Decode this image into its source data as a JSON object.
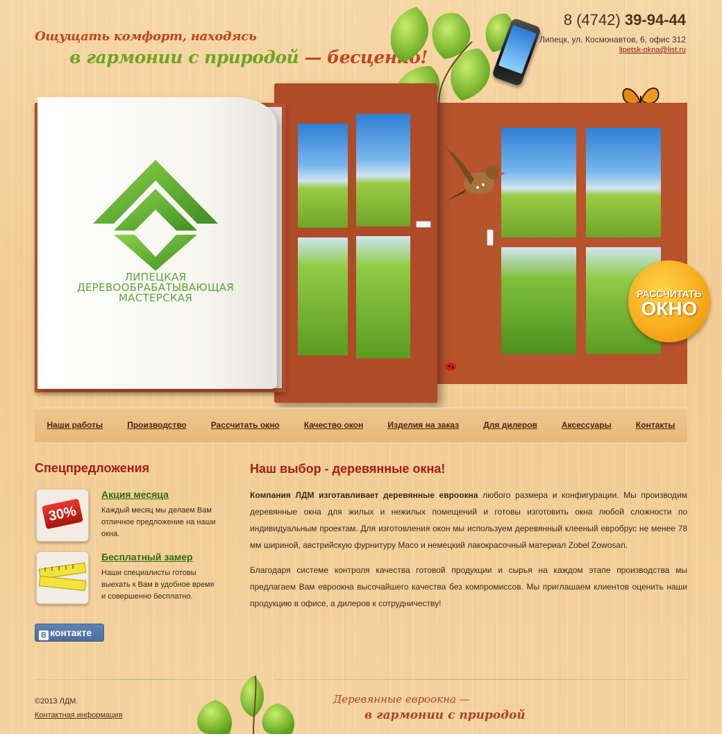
{
  "header": {
    "slogan_line1": "Ощущать комфорт, находясь",
    "slogan_line2_green": "в гармонии с природой",
    "slogan_line2_red": " — бесценно!",
    "phone_prefix": "8 (4742) ",
    "phone_number": "39-94-44",
    "address": "Липецк, ул. Космонавтов, 6, офис 312",
    "email": "lipetsk-okna@list.ru"
  },
  "hero": {
    "logo_line1": "ЛИПЕЦКАЯ",
    "logo_line2": "ДЕРЕВООБРАБАТЫВАЮЩАЯ",
    "logo_line3": "МАСТЕРСКАЯ",
    "calc_line1": "РАССЧИТАТЬ",
    "calc_line2": "ОКНО"
  },
  "menu": {
    "items": [
      {
        "label": "Наши работы"
      },
      {
        "label": "Производство"
      },
      {
        "label": "Рассчитать окно"
      },
      {
        "label": "Качество окон"
      },
      {
        "label": "Изделия на заказ"
      },
      {
        "label": "Для дилеров"
      },
      {
        "label": "Аксессуары"
      },
      {
        "label": "Контакты"
      }
    ]
  },
  "sidebar": {
    "title": "Спецпредложения",
    "offers": [
      {
        "title": "Акция месяца",
        "badge": "30%",
        "text": "Каждый месяц мы делаем Вам отличное предложение на наши окна."
      },
      {
        "title": "Бесплатный замер",
        "text": "Наши специалисты готовы выехать к Вам в удобное время и совершенно бесплатно."
      }
    ],
    "vk_label": "контакте",
    "vk_letter": "В"
  },
  "content": {
    "title": "Наш выбор - деревянные окна!",
    "p1_bold": "Компания ЛДМ изготавливает деревянные евроокна",
    "p1_rest": " любого размера и конфигурации. Мы производим деревянные окна для жилых и нежилых помещений и готовы изготовить окна любой сложности по индивидуальным проектам. Для изготовления окон мы используем деревянный клееный евробрус не менее 78 мм шириной, австрийскую фурнитуру Maco и немецкий лакокрасочный материал Zobel Zowosan.",
    "p2": "Благодаря системе контроля качества готовой продукции и сырья на каждом этапе производства мы предлагаем Вам евроокна высочайшего качества без компромиссов. Мы приглашаем клиентов оценить наши продукцию в офисе, а дилеров к сотрудничеству!"
  },
  "footer": {
    "copyright": "©2013 ЛДМ.",
    "contact_link": "Контактная информация",
    "slogan_line1": "Деревянные евроокна —",
    "slogan_line2": "в гармонии с природой"
  },
  "colors": {
    "accent_red": "#a81c10",
    "accent_green": "#6fa524",
    "frame_wood": "#b5502c",
    "calc_orange": "#f7a91a"
  },
  "icons": [
    "leaf-icon",
    "phone-image",
    "butterfly-icon",
    "bird-image",
    "ladybug-icon",
    "measuring-tape-icon"
  ]
}
